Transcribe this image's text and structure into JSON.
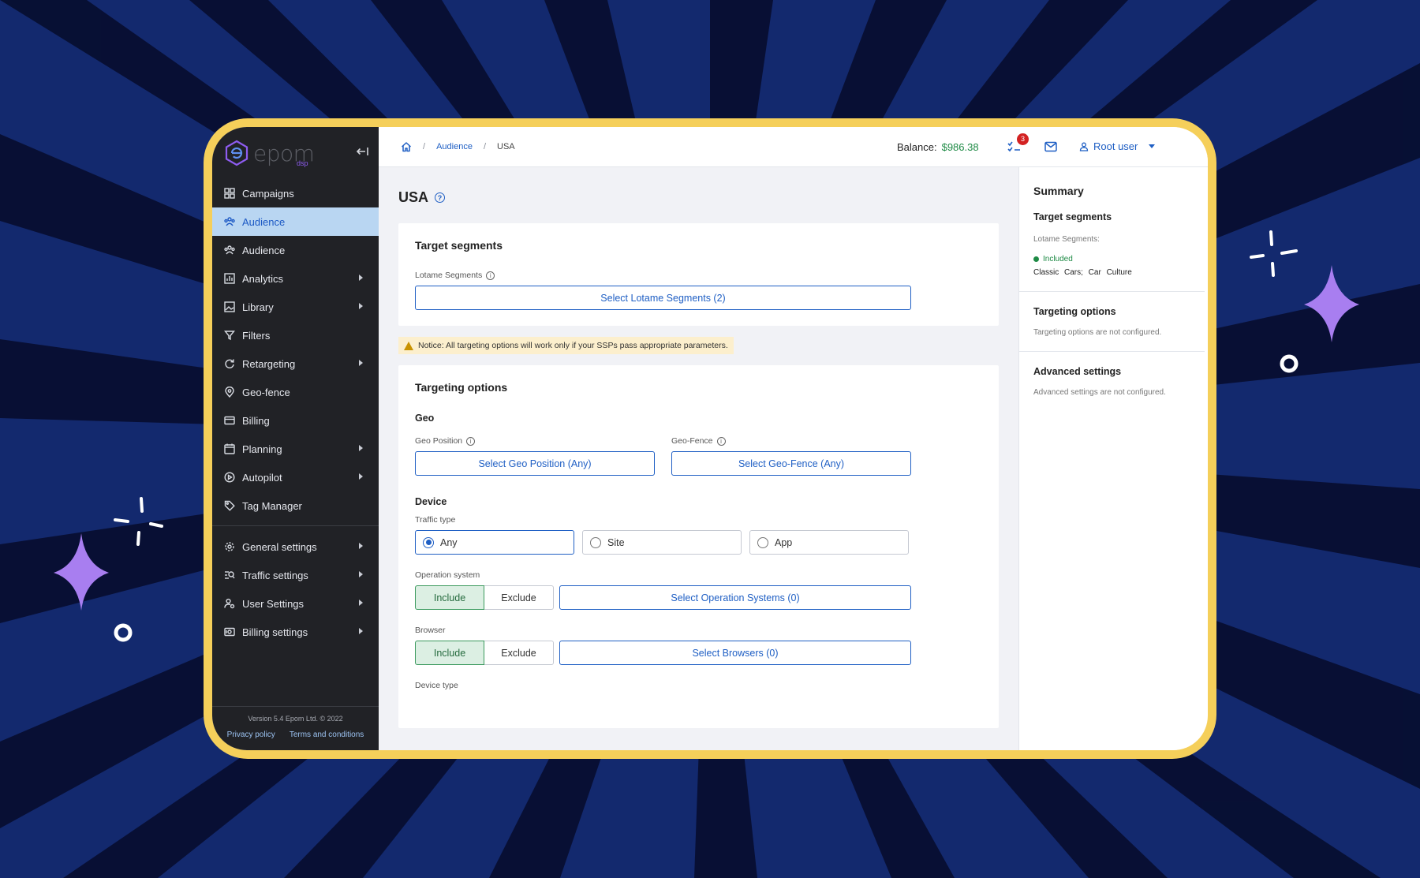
{
  "sidebar": {
    "logo_text": "epom",
    "logo_sub": "dsp",
    "items": [
      {
        "label": "Campaigns",
        "icon": "dashboard-grid-icon",
        "submenu": false,
        "active": false
      },
      {
        "label": "Audience",
        "icon": "people-icon",
        "submenu": false,
        "active": true
      },
      {
        "label": "Audience",
        "icon": "people-icon",
        "submenu": false,
        "active": false
      },
      {
        "label": "Analytics",
        "icon": "bar-chart-icon",
        "submenu": true,
        "active": false
      },
      {
        "label": "Library",
        "icon": "image-icon",
        "submenu": true,
        "active": false
      },
      {
        "label": "Filters",
        "icon": "funnel-icon",
        "submenu": false,
        "active": false
      },
      {
        "label": "Retargeting",
        "icon": "refresh-icon",
        "submenu": true,
        "active": false
      },
      {
        "label": "Geo-fence",
        "icon": "location-pin-icon",
        "submenu": false,
        "active": false
      },
      {
        "label": "Billing",
        "icon": "credit-card-icon",
        "submenu": false,
        "active": false
      },
      {
        "label": "Planning",
        "icon": "calendar-icon",
        "submenu": true,
        "active": false
      },
      {
        "label": "Autopilot",
        "icon": "play-circle-icon",
        "submenu": true,
        "active": false
      },
      {
        "label": "Tag Manager",
        "icon": "tag-icon",
        "submenu": false,
        "active": false
      }
    ],
    "settings_items": [
      {
        "label": "General settings",
        "icon": "gear-icon"
      },
      {
        "label": "Traffic settings",
        "icon": "traffic-search-icon"
      },
      {
        "label": "User Settings",
        "icon": "user-gear-icon"
      },
      {
        "label": "Billing settings",
        "icon": "billing-icon"
      }
    ],
    "version": "Version 5.4 Epom Ltd. © 2022",
    "privacy": "Privacy policy",
    "terms": "Terms and conditions"
  },
  "topbar": {
    "breadcrumb_audience": "Audience",
    "breadcrumb_current": "USA",
    "balance_label": "Balance:",
    "balance_value": "$986.38",
    "tasks_badge": "3",
    "user": "Root user"
  },
  "content": {
    "title": "USA",
    "target_segments": {
      "heading": "Target segments",
      "lotame_label": "Lotame Segments",
      "lotame_button": "Select Lotame Segments (2)"
    },
    "notice": "Notice: All targeting options will work only if your SSPs pass appropriate parameters.",
    "targeting": {
      "heading": "Targeting options",
      "geo_heading": "Geo",
      "geo_position_label": "Geo Position",
      "geo_position_button": "Select Geo Position (Any)",
      "geo_fence_label": "Geo-Fence",
      "geo_fence_button": "Select Geo-Fence (Any)",
      "device_heading": "Device",
      "traffic_type_label": "Traffic type",
      "traffic_any": "Any",
      "traffic_site": "Site",
      "traffic_app": "App",
      "os_label": "Operation system",
      "include": "Include",
      "exclude": "Exclude",
      "os_button": "Select Operation Systems (0)",
      "browser_label": "Browser",
      "browser_button": "Select Browsers (0)",
      "device_type_label": "Device type"
    }
  },
  "summary": {
    "title": "Summary",
    "target_segments": "Target segments",
    "lotame_label": "Lotame Segments:",
    "included": "Included",
    "tags": "Classic Cars;  Car Culture",
    "targeting_options": "Targeting options",
    "targeting_note": "Targeting options are not configured.",
    "advanced": "Advanced settings",
    "advanced_note": "Advanced settings are not configured."
  },
  "colors": {
    "background": "#0f1f5c",
    "frame": "#f5cf5a",
    "sidebar": "#212226",
    "active_item": "#b9d6f2",
    "accent": "#1f5fc4",
    "balance": "#1e8a45",
    "sparkle": "#a87ef0"
  }
}
